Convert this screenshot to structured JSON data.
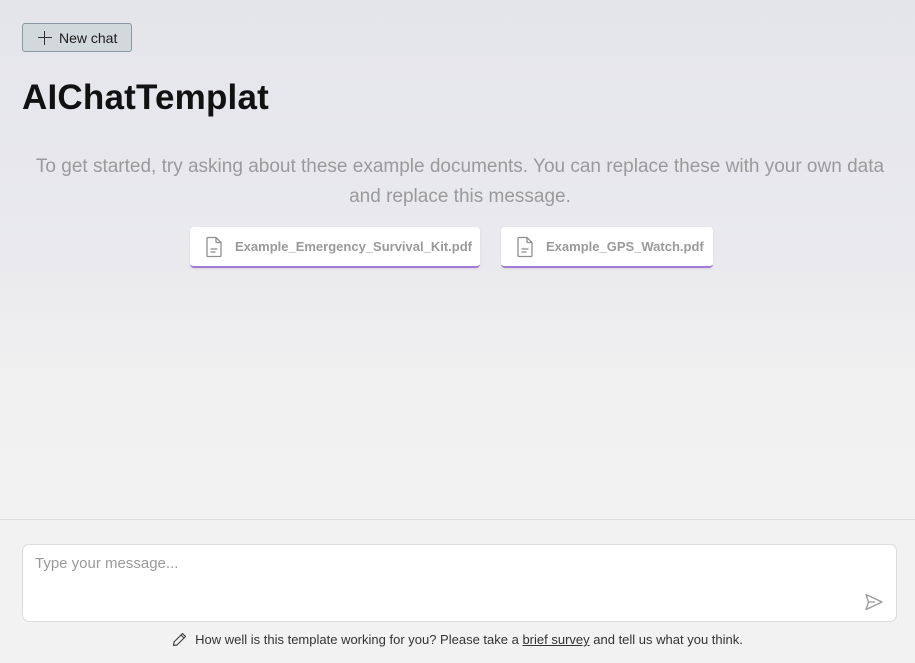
{
  "header": {
    "new_chat_label": "New chat",
    "app_title": "AIChatTemplat"
  },
  "intro": {
    "message": "To get started, try asking about these example documents. You can replace these with your own data and replace this message."
  },
  "documents": [
    {
      "name": "Example_Emergency_Survival_Kit.pdf",
      "icon": "document-icon"
    },
    {
      "name": "Example_GPS_Watch.pdf",
      "icon": "document-icon"
    }
  ],
  "composer": {
    "placeholder": "Type your message...",
    "send_icon": "send-icon"
  },
  "footer": {
    "icon": "pencil-icon",
    "text_before": "How well is this template working for you? Please take a ",
    "link_text": "brief survey",
    "text_after": " and tell us what you think."
  },
  "colors": {
    "accent_underline": "#a47cd4",
    "new_chat_bg": "#d2d9dd",
    "muted_text": "#9a9a9a"
  }
}
